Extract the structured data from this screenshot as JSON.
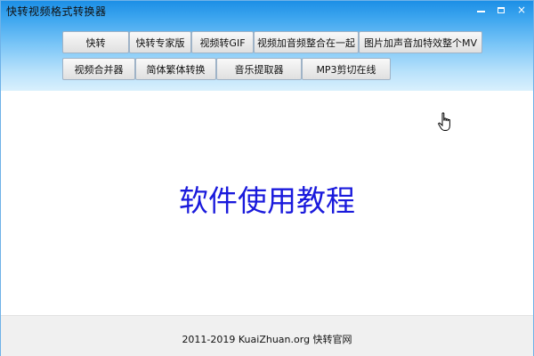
{
  "window": {
    "title": "快转视频格式转换器",
    "controls": {
      "minimize": "minimize-icon",
      "maximize": "maximize-icon",
      "close": "×"
    }
  },
  "toolbar": {
    "row1": [
      "快转",
      "快转专家版",
      "视频转GIF",
      "视频加音频整合在一起",
      "图片加声音加特效整个MV"
    ],
    "row2": [
      "视频合并器",
      "简体繁体转换",
      "音乐提取器",
      "MP3剪切在线"
    ]
  },
  "main": {
    "tutorial_link": "软件使用教程",
    "link_color": "#1a1adc"
  },
  "footer": {
    "text": "2011-2019 KuaiZhuan.org 快转官网"
  },
  "colors": {
    "titlebar": "#1c8fe6",
    "gradient_end": "#d9f0fd"
  }
}
